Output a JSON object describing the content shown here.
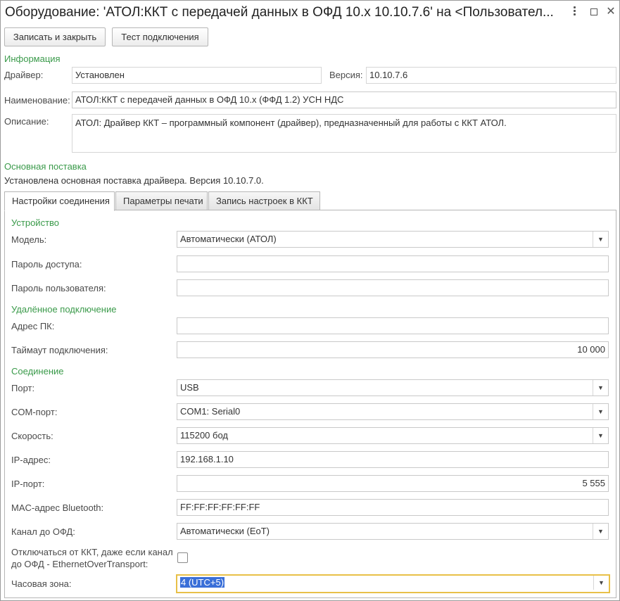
{
  "window": {
    "title": "Оборудование: 'АТОЛ:ККТ с передачей данных в ОФД 10.х 10.10.7.6' на <Пользовател..."
  },
  "toolbar": {
    "save_label": "Записать и закрыть",
    "test_label": "Тест подключения"
  },
  "info": {
    "section": "Информация",
    "driver_label": "Драйвер:",
    "driver_value": "Установлен",
    "version_label": "Версия:",
    "version_value": "10.10.7.6",
    "name_label": "Наименование:",
    "name_value": "АТОЛ:ККТ с передачей данных в ОФД 10.х (ФФД 1.2) УСН НДС",
    "desc_label": "Описание:",
    "desc_value": "АТОЛ: Драйвер ККТ – программный компонент (драйвер), предназначенный для работы с ККТ АТОЛ."
  },
  "delivery": {
    "section": "Основная поставка",
    "text": "Установлена основная поставка драйвера. Версия 10.10.7.0."
  },
  "tabs": [
    {
      "label": "Настройки соединения"
    },
    {
      "label": "Параметры печати"
    },
    {
      "label": "Запись настроек в ККТ"
    }
  ],
  "device": {
    "section": "Устройство",
    "model_label": "Модель:",
    "model_value": "Автоматически (АТОЛ)",
    "password_label": "Пароль доступа:",
    "password_value": "",
    "user_password_label": "Пароль пользователя:",
    "user_password_value": ""
  },
  "remote": {
    "section": "Удалённое подключение",
    "pc_label": "Адрес ПК:",
    "pc_value": "",
    "timeout_label": "Таймаут подключения:",
    "timeout_value": "10 000"
  },
  "connection": {
    "section": "Соединение",
    "port_label": "Порт:",
    "port_value": "USB",
    "com_label": "COM-порт:",
    "com_value": "COM1: Serial0",
    "speed_label": "Скорость:",
    "speed_value": "115200 бод",
    "ip_label": "IP-адрес:",
    "ip_value": "192.168.1.10",
    "ipport_label": "IP-порт:",
    "ipport_value": "5 555",
    "mac_label": "MAC-адрес Bluetooth:",
    "mac_value": "FF:FF:FF:FF:FF:FF",
    "ofd_label": "Канал до ОФД:",
    "ofd_value": "Автоматически (EoT)",
    "disconnect_label_1": "Отключаться от ККТ, даже если канал",
    "disconnect_label_2": "до ОФД - EthernetOverTransport:",
    "disconnect_checked": false,
    "tz_label": "Часовая зона:",
    "tz_value": "4 (UTC+5)"
  }
}
